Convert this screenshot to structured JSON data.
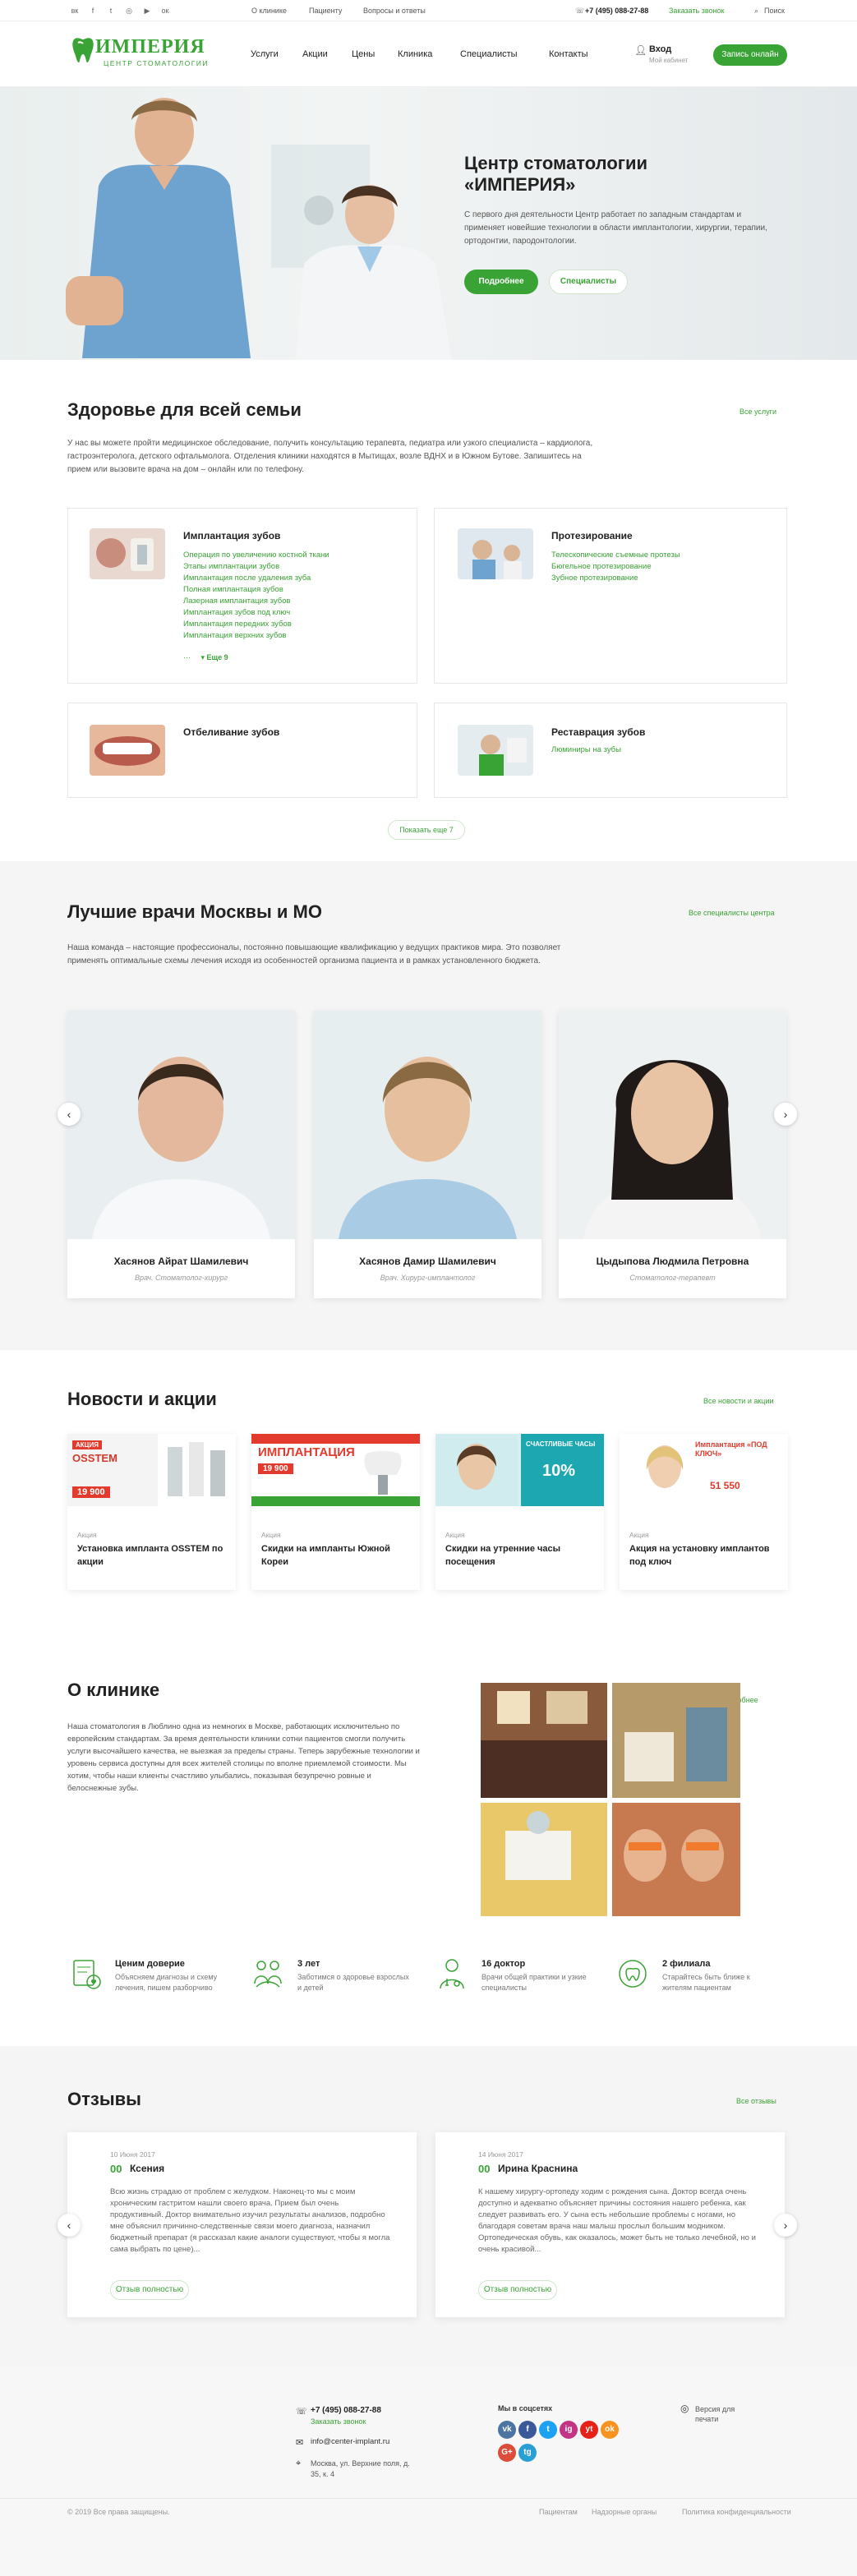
{
  "topbar": {
    "social_icons": [
      "vk-icon",
      "facebook-icon",
      "twitter-icon",
      "instagram-icon",
      "youtube-icon",
      "odnoklassniki-icon"
    ],
    "links": [
      "О клинике",
      "Пациенту",
      "Вопросы и ответы"
    ],
    "phone": "+7 (495) 088-27-88",
    "callback": "Заказать звонок",
    "search": "Поиск"
  },
  "header": {
    "logo_title": "ИМПЕРИЯ",
    "logo_subtitle": "ЦЕНТР СТОМАТОЛОГИИ",
    "nav": [
      "Услуги",
      "Акции",
      "Цены",
      "Клиника",
      "Специалисты",
      "Контакты"
    ],
    "login": "Вход",
    "login_sub": "Мой кабинет",
    "cta": "Запись онлайн"
  },
  "hero": {
    "title_line1": "Центр стоматологии",
    "title_line2": "«ИМПЕРИЯ»",
    "text": "С первого дня деятельности Центр работает по западным стандартам и применяет новейшие технологии в области имплантологии, хирургии, терапии, ортодонтии, пародонтологии.",
    "btn_more": "Подробнее",
    "btn_specialists": "Специалисты"
  },
  "services": {
    "title": "Здоровье для всей семьи",
    "all_link": "Все услуги",
    "text": "У нас вы можете пройти медицинское обследование, получить консультацию терапевта, педиатра или узкого специалиста – кардиолога, гастроэнтеролога, детского офтальмолога. Отделения клиники находятся в Мытищах, возле ВДНХ и в Южном Бутове. Запишитесь на прием или вызовите врача на дом – онлайн или по телефону.",
    "cards": [
      {
        "title": "Имплантация зубов",
        "links": [
          "Операция по увеличению костной ткани",
          "Этапы имплантации зубов",
          "Имплантация после удаления зуба",
          "Полная имплантация зубов",
          "Лазерная имплантация зубов",
          "Имплантация зубов под ключ",
          "Имплантация передних зубов",
          "Имплантация верхних зубов"
        ],
        "more": "Еще 9"
      },
      {
        "title": "Протезирование",
        "links": [
          "Телескопические съемные протезы",
          "Бюгельное протезирование",
          "Зубное протезирование"
        ]
      },
      {
        "title": "Отбеливание зубов",
        "links": []
      },
      {
        "title": "Реставрация зубов",
        "links": [
          "Люминиры на зубы"
        ]
      }
    ],
    "show_more": "Показать еще 7"
  },
  "doctors": {
    "title": "Лучшие врачи Москвы и МО",
    "all_link": "Все специалисты центра",
    "text": "Наша команда – настоящие профессионалы, постоянно повышающие квалификацию у ведущих практиков мира. Это позволяет применять оптимальные схемы лечения исходя из особенностей организма пациента и в рамках установленного бюджета.",
    "items": [
      {
        "name": "Хасянов Айрат Шамилевич",
        "position": "Врач. Стоматолог-хирург"
      },
      {
        "name": "Хасянов Дамир Шамилевич",
        "position": "Врач. Хирург-имплантолог"
      },
      {
        "name": "Цыдыпова Людмила Петровна",
        "position": "Стоматолог-терапевт"
      }
    ]
  },
  "news": {
    "title": "Новости и акции",
    "all_link": "Все новости и акции",
    "items": [
      {
        "category": "Акция",
        "title": "Установка импланта OSSTEM по акции",
        "img_title": "АКЦИЯ",
        "img_brand": "OSSTEM",
        "img_price": "19 900"
      },
      {
        "category": "Акция",
        "title": "Скидки на импланты Южной Кореи",
        "img_title": "ИМПЛАНТАЦИЯ",
        "img_price": "19 900"
      },
      {
        "category": "Акция",
        "title": "Скидки на утренние часы посещения",
        "img_title": "СЧАСТЛИВЫЕ ЧАСЫ",
        "img_price": "10%"
      },
      {
        "category": "Акция",
        "title": "Акция на установку имплантов под ключ",
        "img_title": "Имплантация «ПОД КЛЮЧ»",
        "img_price": "51 550"
      }
    ]
  },
  "about": {
    "title": "О клинике",
    "more_link": "Подробнее",
    "text": "Наша стоматология в Люблино одна из немногих в Москве, работающих исключительно по европейским стандартам. За время деятельности клиники сотни пациентов смогли получить услуги высочайшего качества, не выезжая за пределы страны. Теперь зарубежные технологии и уровень сервиса доступны для всех жителей столицы по вполне приемлемой стоимости. Мы хотим, чтобы наши клиенты счастливо улыбались, показывая безупречно ровные и белоснежные зубы."
  },
  "features": [
    {
      "icon": "document-heart-icon",
      "title": "Ценим доверие",
      "text": "Объясняем диагнозы и схему лечения, пишем разборчиво"
    },
    {
      "icon": "family-icon",
      "title": "3 лет",
      "text": "Заботимся о здоровье взрослых и детей"
    },
    {
      "icon": "doctor-icon",
      "title": "16 доктор",
      "text": "Врачи общей практики и узкие специалисты"
    },
    {
      "icon": "clinic-branch-icon",
      "title": "2 филиала",
      "text": "Старайтесь быть ближе к жителям пациентам"
    }
  ],
  "reviews": {
    "title": "Отзывы",
    "all_link": "Все отзывы",
    "items": [
      {
        "date": "10 Июня 2017",
        "name": "Ксения",
        "text": "Всю жизнь страдаю от проблем с желудком. Наконец-то мы с моим хроническим гастритом нашли своего врача. Прием был очень продуктивный. Доктор внимательно изучил результаты анализов, подробно мне объяснил причинно-следственные связи моего диагноза, назначил бюджетный препарат (я рассказал какие аналоги существуют, чтобы я могла сама выбрать по цене)...",
        "button": "Отзыв полностью"
      },
      {
        "date": "14 Июня 2017",
        "name": "Ирина Краснина",
        "text": "К нашему хирургу-ортопеду ходим с рождения сына. Доктор всегда очень доступно и адекватно объясняет причины состояния нашего ребенка, как следует развивать его. У сына есть небольшие проблемы с ногами, но благодаря советам врача наш малыш прослыл большим модником. Ортопедическая обувь, как оказалось, может быть не только лечебной, но и очень красивой...",
        "button": "Отзыв полностью"
      }
    ]
  },
  "footer": {
    "phone": "+7 (495) 088-27-88",
    "callback": "Заказать звонок",
    "email": "info@center-implant.ru",
    "address": "Москва, ул. Верхние поля, д. 35, к. 4",
    "social_title": "Мы в соцсетях",
    "social_colors": [
      "#4c75a3",
      "#3b5998",
      "#1da1f2",
      "#c13584",
      "#e62117",
      "#f7931e",
      "#dd4b39",
      "#2a9fd6"
    ],
    "social_labels": [
      "vk",
      "f",
      "t",
      "ig",
      "yt",
      "ok",
      "G+",
      "tg"
    ],
    "blind_version": "Версия для печати",
    "copyright": "© 2019 Все права защищены.",
    "links": [
      "Пациентам",
      "Надзорные органы",
      "Политика конфиденциальности"
    ]
  },
  "colors": {
    "accent": "#3aa335",
    "text": "#222222",
    "muted": "#777777"
  }
}
